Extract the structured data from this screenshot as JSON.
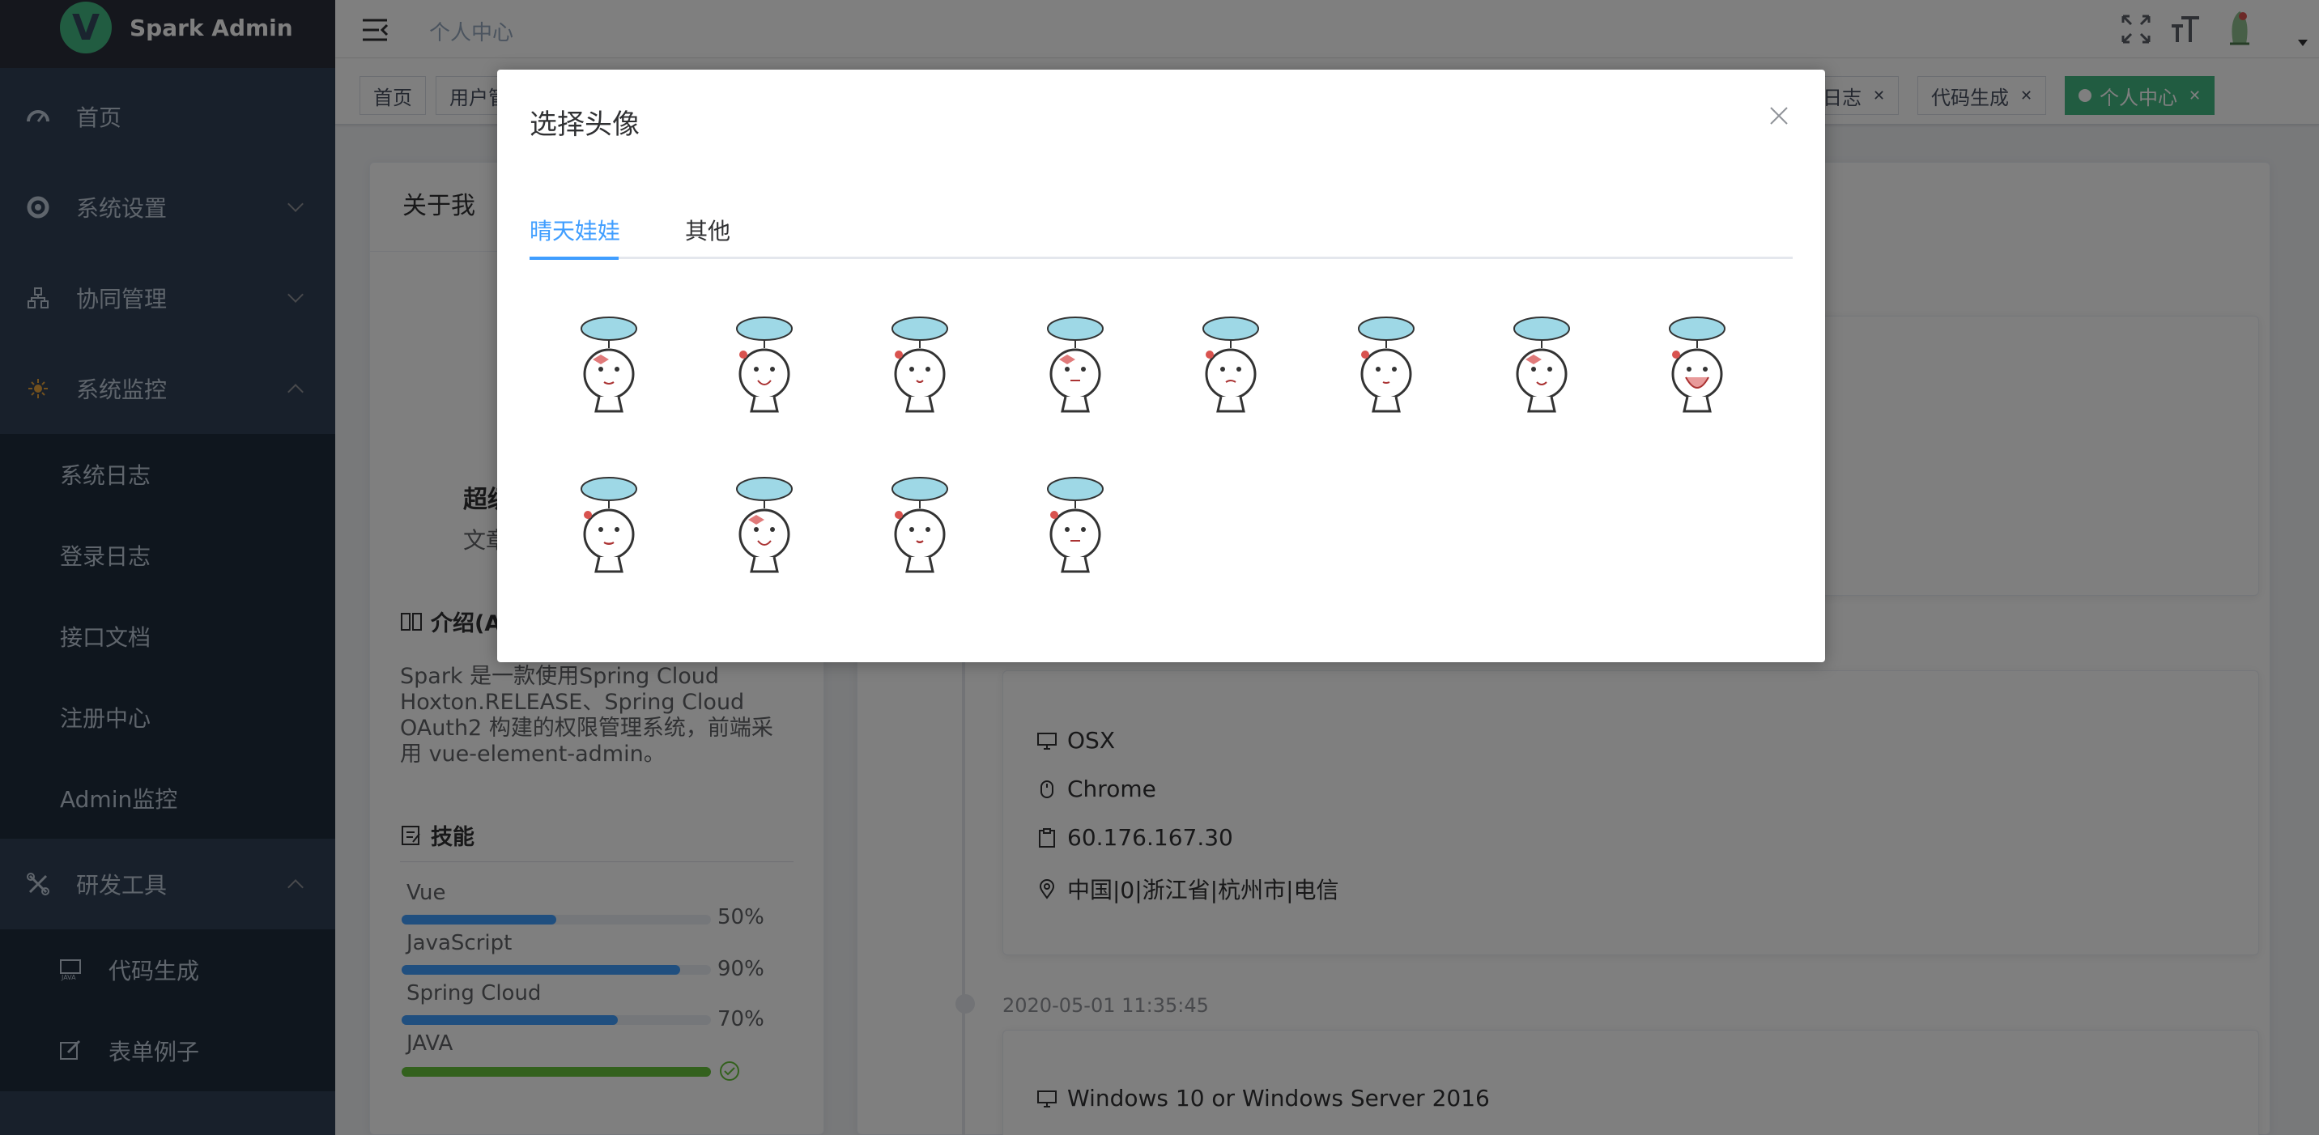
{
  "app": {
    "name": "Spark Admin",
    "logo_letter": "V"
  },
  "sidebar": {
    "items": [
      {
        "label": "首页",
        "icon": "dashboard-icon"
      },
      {
        "label": "系统设置",
        "icon": "settings-icon"
      },
      {
        "label": "协同管理",
        "icon": "network-icon"
      },
      {
        "label": "系统监控",
        "icon": "monitor-icon"
      },
      {
        "label": "研发工具",
        "icon": "tools-icon"
      }
    ],
    "monitor_sub": [
      "系统日志",
      "登录日志",
      "接口文档",
      "注册中心",
      "Admin监控"
    ],
    "tools_sub": [
      {
        "label": "代码生成",
        "icon": "java-icon"
      },
      {
        "label": "表单例子",
        "icon": "edit-icon"
      }
    ]
  },
  "navbar": {
    "breadcrumb": "个人中心"
  },
  "tags": {
    "first": "首页",
    "second": "用户管",
    "log": "日志",
    "codegen": "代码生成",
    "profile": "个人中心"
  },
  "profile": {
    "about_title": "关于我",
    "name_partial": "超级",
    "article_partial": "文章",
    "intro_title": "介绍(A",
    "intro_text": "Spark 是一款使用Spring Cloud Hoxton.RELEASE、Spring Cloud OAuth2 构建的权限管理系统，前端采用 vue-element-admin。",
    "skills_title": "技能",
    "skills": [
      {
        "name": "Vue",
        "pct": "50%",
        "value": 0.5
      },
      {
        "name": "JavaScript",
        "pct": "90%",
        "value": 0.9
      },
      {
        "name": "Spring Cloud",
        "pct": "70%",
        "value": 0.7
      },
      {
        "name": "JAVA",
        "value": 1.0
      }
    ]
  },
  "login_log": {
    "entry1": {
      "os": "OSX",
      "browser": "Chrome",
      "ip": "60.176.167.30",
      "location": "中国|0|浙江省|杭州市|电信"
    },
    "entry2": {
      "time": "2020-05-01 11:35:45",
      "os": "Windows 10 or Windows Server 2016"
    }
  },
  "dialog": {
    "title": "选择头像",
    "tabs": [
      "晴天娃娃",
      "其他"
    ],
    "avatar_count": 12
  },
  "colors": {
    "primary": "#409eff",
    "success": "#67c23a",
    "sidebar": "#304156",
    "active_tag": "#42b983"
  }
}
